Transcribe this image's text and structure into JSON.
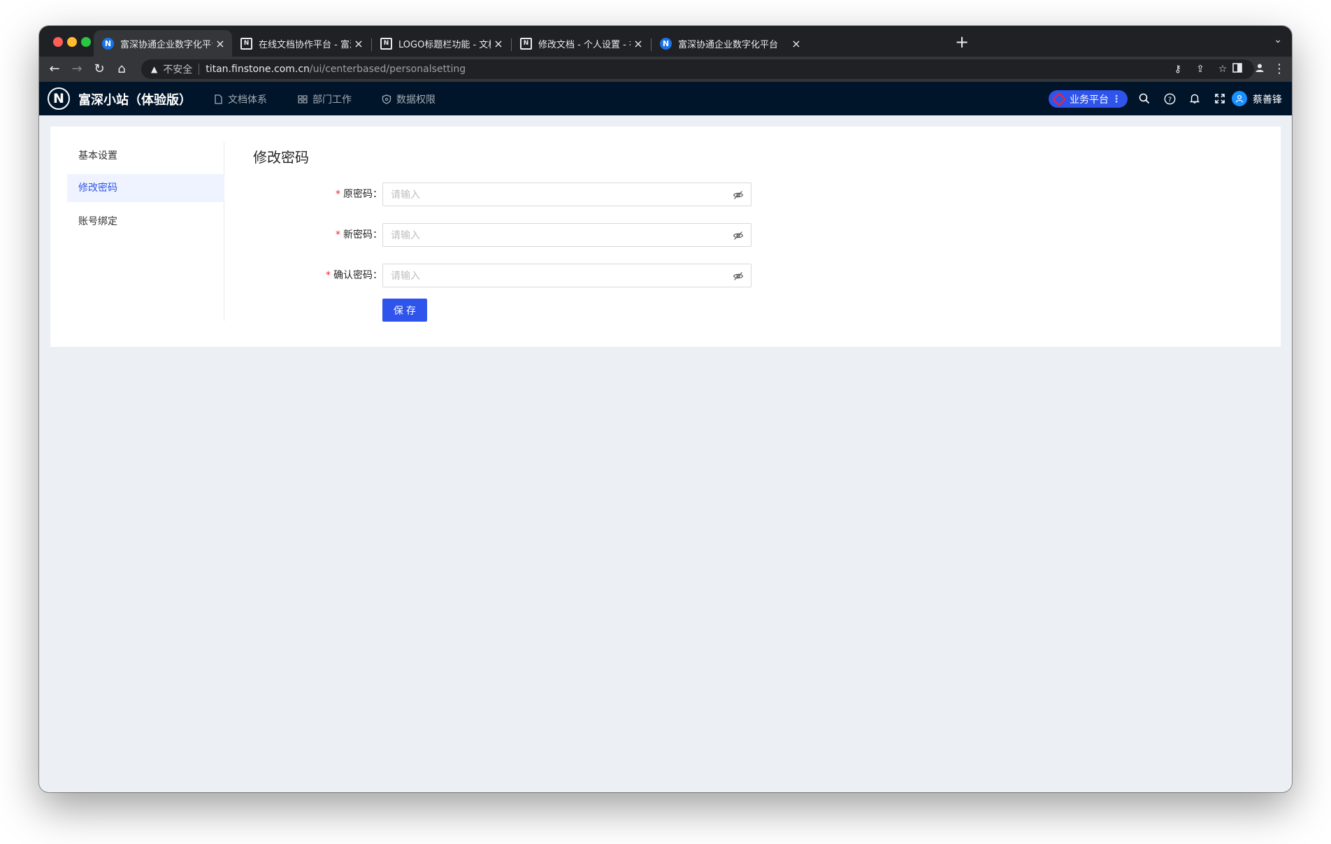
{
  "browser": {
    "tabs": [
      {
        "title": "富深协通企业数字化平台",
        "favicon": "n-logo-icon"
      },
      {
        "title": "在线文档协作平台 - 富深协通",
        "favicon": "doc-icon"
      },
      {
        "title": "LOGO标题栏功能 - 文档管理平台",
        "favicon": "doc-icon"
      },
      {
        "title": "修改文档 - 个人设置 - 在线文档协作",
        "favicon": "doc-icon"
      },
      {
        "title": "富深协通企业数字化平台",
        "favicon": "n-logo-icon"
      }
    ],
    "address": {
      "security_label": "不安全",
      "host": "titan.finstone.com.cn",
      "path": "/ui/centerbased/personalsetting"
    }
  },
  "app": {
    "logo_letter": "N",
    "name": "富深小站（体验版）",
    "nav": [
      {
        "label": "文档体系",
        "icon": "file-icon"
      },
      {
        "label": "部门工作",
        "icon": "grid-icon"
      },
      {
        "label": "数据权限",
        "icon": "shield-icon"
      }
    ],
    "platform_button": "业务平台",
    "user_name": "蔡善锋"
  },
  "settings": {
    "menu": [
      {
        "label": "基本设置",
        "active": false
      },
      {
        "label": "修改密码",
        "active": true
      },
      {
        "label": "账号绑定",
        "active": false
      }
    ],
    "title": "修改密码",
    "fields": [
      {
        "label": "原密码：",
        "placeholder": "请输入",
        "required": true
      },
      {
        "label": "新密码：",
        "placeholder": "请输入",
        "required": true
      },
      {
        "label": "确认密码：",
        "placeholder": "请输入",
        "required": true
      }
    ],
    "save_label": "保存"
  },
  "colors": {
    "primary": "#2f54eb",
    "header_bg": "#00142a",
    "page_bg": "#eceff4",
    "required": "#f5222d"
  }
}
